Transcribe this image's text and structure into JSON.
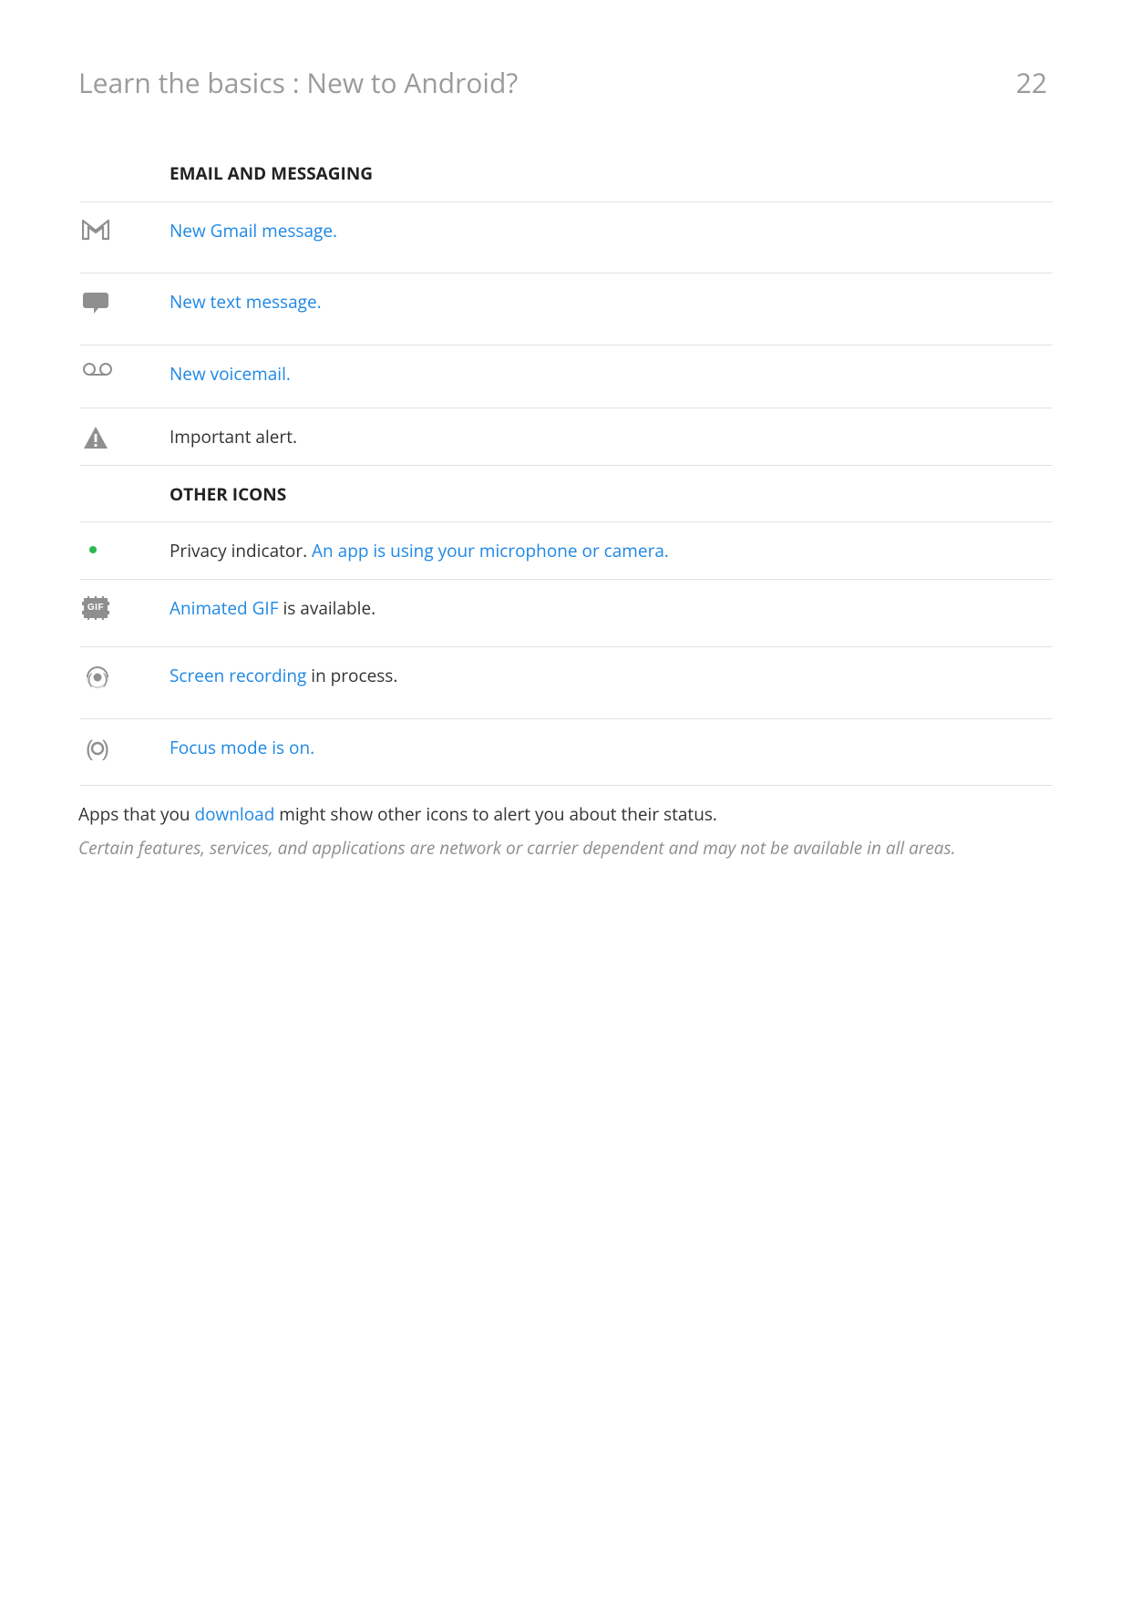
{
  "header": {
    "breadcrumb": "Learn the basics : New to Android?",
    "page_number": "22"
  },
  "sections": {
    "email_heading": "EMAIL AND MESSAGING",
    "other_heading": "OTHER ICONS"
  },
  "rows": {
    "gmail": {
      "link": "New Gmail message."
    },
    "text_message": {
      "link": "New text message."
    },
    "voicemail": {
      "link": "New voicemail."
    },
    "alert": {
      "text": "Important alert."
    },
    "privacy": {
      "prefix": "Privacy indicator. ",
      "link": "An app is using your microphone or camera."
    },
    "gif": {
      "link": "Animated GIF",
      "suffix": " is available.",
      "icon_label": "GIF"
    },
    "screen_recording": {
      "link": "Screen recording",
      "suffix": " in process."
    },
    "focus": {
      "link": "Focus mode is on."
    }
  },
  "footer": {
    "prefix": "Apps that you ",
    "link": "download",
    "suffix": " might show other icons to alert you about their status.",
    "disclaimer": "Certain features, services, and applications are network or carrier dependent and may not be available in all areas."
  }
}
